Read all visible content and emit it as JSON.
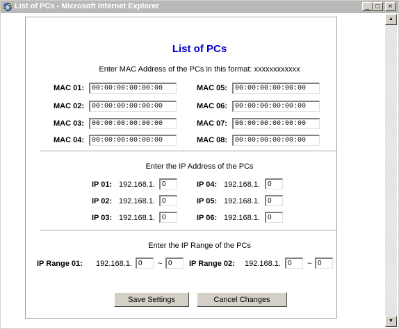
{
  "window": {
    "title": "List of PCs - Microsoft Internet Explorer",
    "controls": [
      "_",
      "□",
      "×"
    ]
  },
  "page": {
    "title": "List of PCs",
    "mac_instruction": "Enter MAC Address of the PCs in this format: xxxxxxxxxxxx",
    "ip_instruction": "Enter the IP Address of the PCs",
    "range_instruction": "Enter the IP Range of the PCs"
  },
  "mac": [
    {
      "label": "MAC 01:",
      "value": "00:00:00:00:00:00"
    },
    {
      "label": "MAC 02:",
      "value": "00:00:00:00:00:00"
    },
    {
      "label": "MAC 03:",
      "value": "00:00:00:00:00:00"
    },
    {
      "label": "MAC 04:",
      "value": "00:00:00:00:00:00"
    },
    {
      "label": "MAC 05:",
      "value": "00:00:00:00:00:00"
    },
    {
      "label": "MAC 06:",
      "value": "00:00:00:00:00:00"
    },
    {
      "label": "MAC 07:",
      "value": "00:00:00:00:00:00"
    },
    {
      "label": "MAC 08:",
      "value": "00:00:00:00:00:00"
    }
  ],
  "ip": [
    {
      "label": "IP 01:",
      "prefix": "192.168.1.",
      "value": "0"
    },
    {
      "label": "IP 02:",
      "prefix": "192.168.1.",
      "value": "0"
    },
    {
      "label": "IP 03:",
      "prefix": "192.168.1.",
      "value": "0"
    },
    {
      "label": "IP 04:",
      "prefix": "192.168.1.",
      "value": "0"
    },
    {
      "label": "IP 05:",
      "prefix": "192.168.1.",
      "value": "0"
    },
    {
      "label": "IP 06:",
      "prefix": "192.168.1.",
      "value": "0"
    }
  ],
  "range": [
    {
      "label": "IP Range 01:",
      "prefix": "192.168.1.",
      "start": "0",
      "separator": "~",
      "end": "0"
    },
    {
      "label": "IP Range 02:",
      "prefix": "192.168.1.",
      "start": "0",
      "separator": "~",
      "end": "0"
    }
  ],
  "buttons": {
    "save": "Save Settings",
    "cancel": "Cancel Changes"
  },
  "icons": {
    "app": "ie-logo-icon",
    "minimize": "minimize-icon",
    "maximize": "maximize-icon",
    "close": "close-icon",
    "scroll_up": "scroll-up-icon",
    "scroll_down": "scroll-down-icon"
  }
}
